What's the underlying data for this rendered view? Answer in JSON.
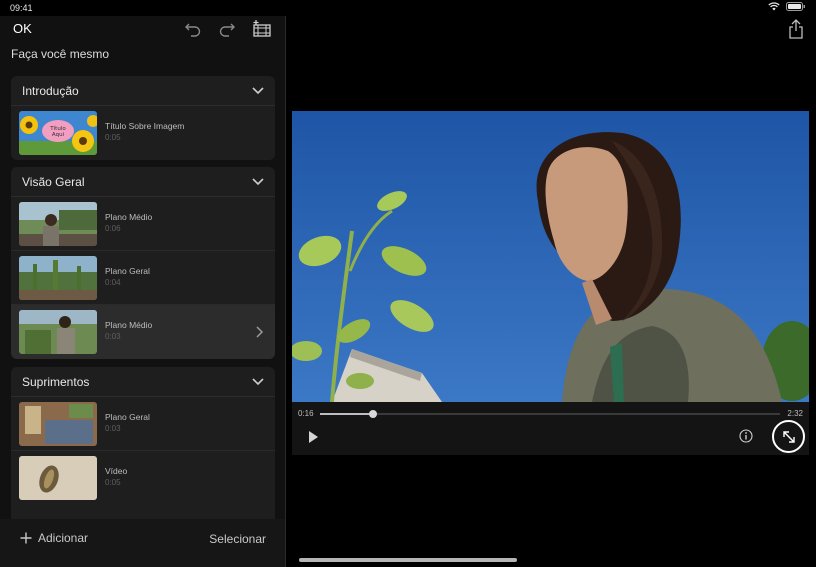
{
  "status": {
    "time": "09:41"
  },
  "toolbar": {
    "done_label": "OK"
  },
  "project": {
    "title": "Faça você mesmo"
  },
  "sections": [
    {
      "title": "Introdução",
      "clips": [
        {
          "name": "Título Sobre Imagem",
          "duration": "0:05",
          "thumb_text": "Título Aqui"
        }
      ]
    },
    {
      "title": "Visão Geral",
      "clips": [
        {
          "name": "Plano Médio",
          "duration": "0:06"
        },
        {
          "name": "Plano Geral",
          "duration": "0:04"
        },
        {
          "name": "Plano Médio",
          "duration": "0:03",
          "selected": true
        }
      ]
    },
    {
      "title": "Suprimentos",
      "clips": [
        {
          "name": "Plano Geral",
          "duration": "0:03"
        },
        {
          "name": "Vídeo",
          "duration": "0:05"
        }
      ]
    }
  ],
  "bottom": {
    "add_label": "Adicionar",
    "select_label": "Selecionar"
  },
  "player": {
    "current_time": "0:16",
    "total_time": "2:32",
    "progress": 0.115
  },
  "colors": {
    "accent": "#ffffff",
    "panel": "#1e1e1e",
    "selected_row": "#2c2c2c",
    "sky": "#2e64b3"
  }
}
